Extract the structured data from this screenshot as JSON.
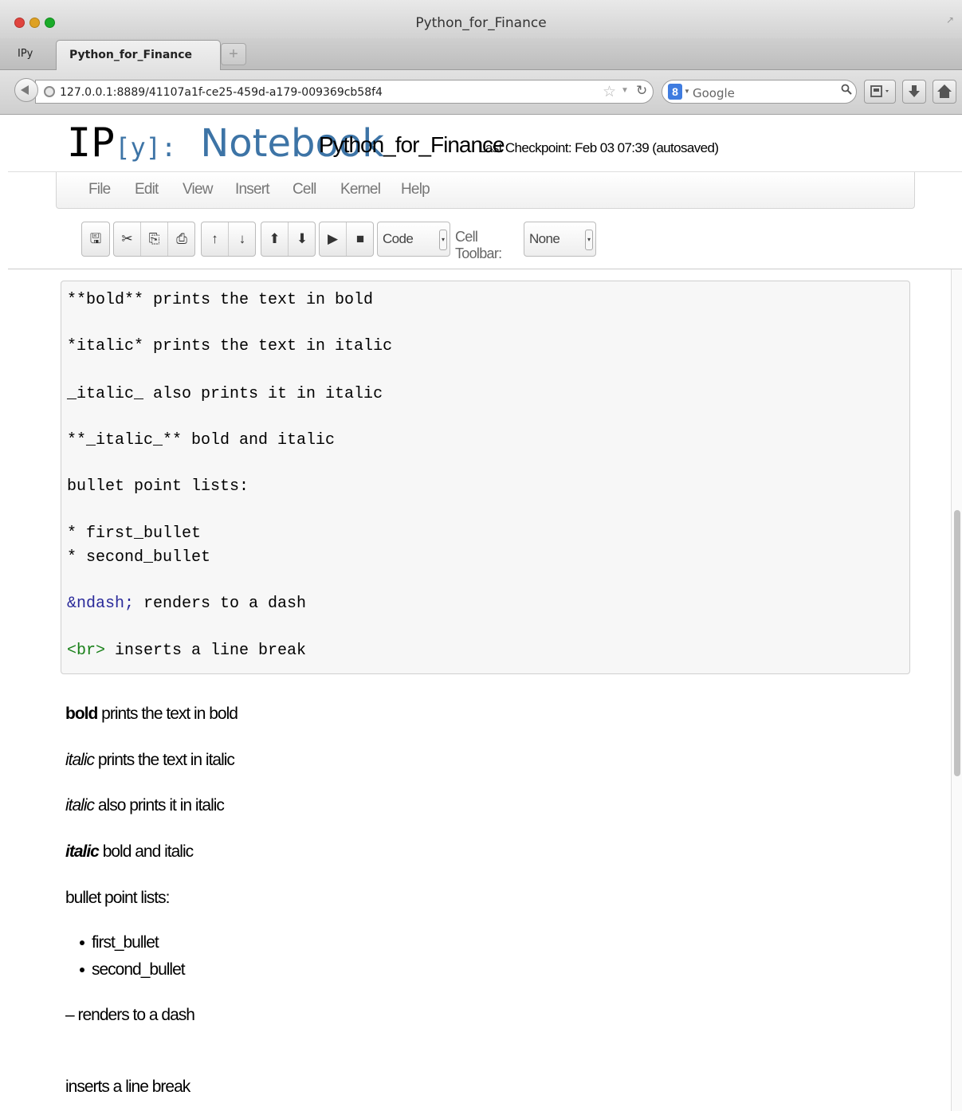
{
  "window": {
    "title": "Python_for_Finance"
  },
  "tabs": {
    "favicon_label": "IPy",
    "active_label": "Python_for_Finance",
    "new_tab_label": "+"
  },
  "navbar": {
    "url": "127.0.0.1:8889/41107a1f-ce25-459d-a179-009369cb58f4",
    "search_placeholder": "Google",
    "search_engine_icon_letter": "8",
    "icons": [
      "back-arrow-icon",
      "site-identity-icon",
      "bookmark-star-icon",
      "reload-icon",
      "search-icon",
      "addon-icon",
      "download-icon",
      "home-icon"
    ]
  },
  "header": {
    "logo_ip": "IP",
    "logo_y": "[y]:",
    "logo_notebook": "Notebook",
    "notebook_name": "Python_for_Finance",
    "checkpoint": "Last Checkpoint: Feb 03 07:39 (autosaved)"
  },
  "menu": {
    "items": [
      "File",
      "Edit",
      "View",
      "Insert",
      "Cell",
      "Kernel",
      "Help"
    ]
  },
  "toolbar": {
    "buttons": [
      "save-icon",
      "cut-icon",
      "copy-icon",
      "paste-icon",
      "move-up-icon",
      "move-down-icon",
      "insert-above-icon",
      "insert-below-icon",
      "run-icon",
      "stop-icon"
    ],
    "cell_type_value": "Code",
    "cell_toolbar_label": "Cell Toolbar:",
    "cell_toolbar_value": "None"
  },
  "editor_cell": {
    "lines": [
      "**bold** prints the text in bold",
      "*italic* prints the text in italic",
      "_italic_ also prints it in italic",
      "**_italic_** bold and italic",
      "bullet point lists:",
      "* first_bullet",
      "* second_bullet",
      "&ndash;",
      " renders to a dash",
      "<br>",
      " inserts a line break"
    ]
  },
  "rendered_cell": {
    "bold_word": "bold",
    "bold_rest": " prints the text in bold",
    "italic_word": "italic",
    "italic_rest": " prints the text in italic",
    "italic2_word": "italic",
    "italic2_rest": " also prints it in italic",
    "bolditalic_word": "italic",
    "bolditalic_rest": " bold and italic",
    "list_heading": "bullet point lists:",
    "bullets": [
      "first_bullet",
      "second_bullet"
    ],
    "dash_line": "– renders to a dash",
    "break_line": "inserts a line break"
  }
}
